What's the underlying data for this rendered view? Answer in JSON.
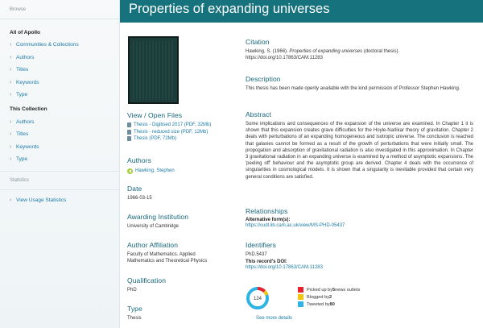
{
  "page": {
    "title": "Properties of expanding universes"
  },
  "sidebar": {
    "browse_header": "Browse",
    "all_of_apollo": "All of Apollo",
    "all_items": [
      "Communities & Collections",
      "Authors",
      "Titles",
      "Keywords",
      "Type"
    ],
    "this_collection": "This Collection",
    "collection_items": [
      "Authors",
      "Titles",
      "Keywords",
      "Type"
    ],
    "statistics": "Statistics",
    "usage_stats": "View Usage Statistics"
  },
  "files": {
    "heading": "View / Open Files",
    "items": [
      "Thesis - Digitised 2017 (PDF, 32Mb)",
      "Thesis - reduced size (PDF, 12Mb)",
      "Thesis (PDF, 72Mb)"
    ]
  },
  "authors": {
    "heading": "Authors",
    "name": "Hawking, Stephen"
  },
  "date": {
    "heading": "Date",
    "value": "1966-03-15"
  },
  "institution": {
    "heading": "Awarding Institution",
    "value": "University of Cambridge"
  },
  "affiliation": {
    "heading": "Author Affiliation",
    "line1": "Faculty of Mathematics. Applied",
    "line2": "Mathematics and Theoretical Physics"
  },
  "qualification": {
    "heading": "Qualification",
    "value": "PhD"
  },
  "type": {
    "heading": "Type",
    "value": "Thesis"
  },
  "citation": {
    "heading": "Citation",
    "prefix": "Hawking, S. (1966). ",
    "title_italic": "Properties of expanding universes",
    "suffix": " (doctoral thesis).",
    "doi": "https://doi.org/10.17863/CAM.11283"
  },
  "description": {
    "heading": "Description",
    "text": "This thesis has been made openly available with the kind permission of Professor Stephen Hawking."
  },
  "abstract": {
    "heading": "Abstract",
    "text": "Some implications and consequences of the expansion of the universe are examined. In Chapter 1 it is shown that this expansion creates grave difficulties for the Hoyle-Narlikar theory of gravitation. Chapter 2 deals with perturbations of an expanding homogeneous and isotropic universe. The conclusion is reached that galaxies cannot be formed as a result of the growth of perturbations that were initially small. The propogation and absorption of gravitational radiation is also investigated in this approximation. In Chapter 3 gravitational radiation in an expanding universe is examined by a method of asymptotic expansions. The 'peeling off' behaviour and the asymptotic group are derived. Chapter 4 deals with the occurrence of singularities in cosmological models. It is shown that a singularity is inevitable provided that certain very general conditions are satisfied."
  },
  "relationships": {
    "heading": "Relationships",
    "label": "Alternative form(s):",
    "link": "https://cudl.lib.cam.ac.uk/view/MS-PHD-05437"
  },
  "identifiers": {
    "heading": "Identifiers",
    "id": "PhD.5437",
    "doi_label": "This record's DOI:",
    "doi": "https://doi.org/10.17863/CAM.11283"
  },
  "altmetric": {
    "score": "124",
    "rows": [
      {
        "pre": "Picked up by ",
        "count": "5",
        "post": " news outlets",
        "color": "#e8212d"
      },
      {
        "pre": "Blogged by ",
        "count": "2",
        "post": "",
        "color": "#f1c40f"
      },
      {
        "pre": "Tweeted by ",
        "count": "80",
        "post": "",
        "color": "#2fb2e4"
      }
    ],
    "more": "See more details"
  }
}
